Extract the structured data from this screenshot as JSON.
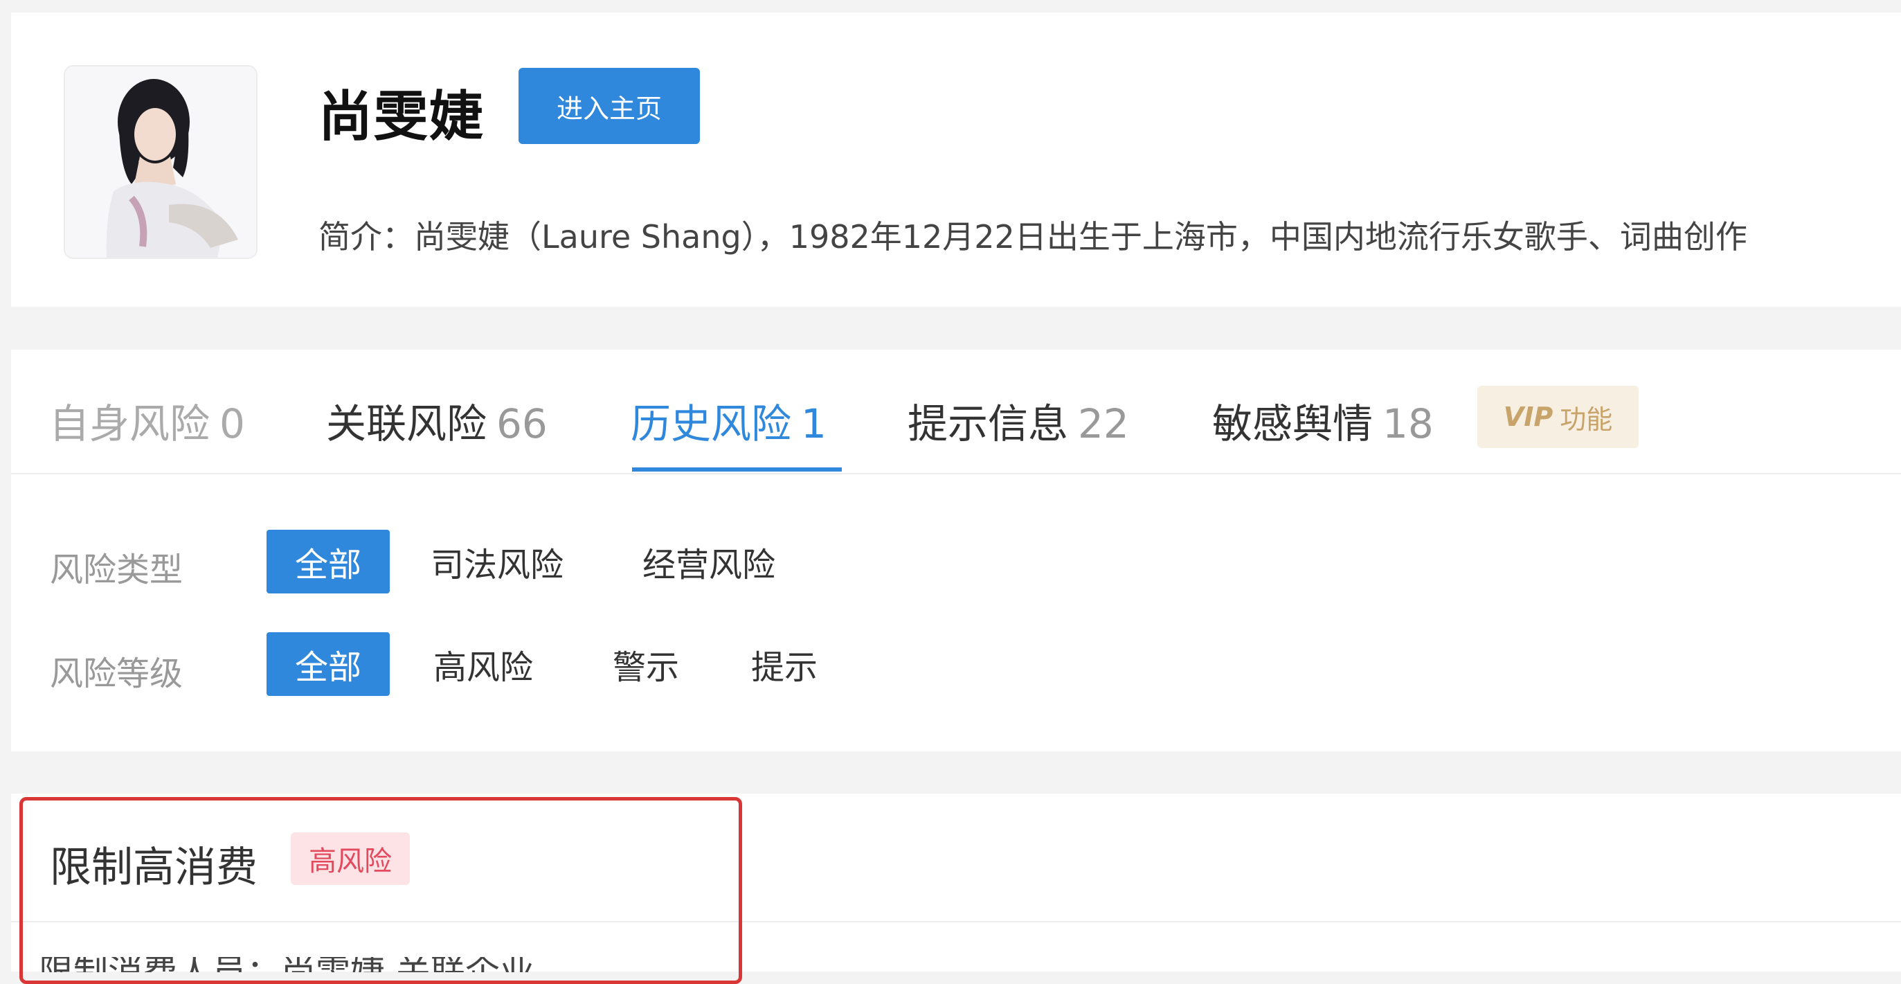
{
  "profile": {
    "name": "尚雯婕",
    "home_button": "进入主页",
    "intro": "简介：尚雯婕（Laure Shang），1982年12月22日出生于上海市，中国内地流行乐女歌手、词曲创作"
  },
  "tabs": [
    {
      "label": "自身风险",
      "count": "0",
      "state": "disabled"
    },
    {
      "label": "关联风险",
      "count": "66",
      "state": "normal"
    },
    {
      "label": "历史风险",
      "count": "1",
      "state": "active"
    },
    {
      "label": "提示信息",
      "count": "22",
      "state": "normal"
    },
    {
      "label": "敏感舆情",
      "count": "18",
      "state": "normal"
    }
  ],
  "vip": {
    "mark": "VIP",
    "text": "功能"
  },
  "filters": {
    "risk_type": {
      "label": "风险类型",
      "options": [
        "全部",
        "司法风险",
        "经营风险"
      ],
      "selected": "全部"
    },
    "risk_level": {
      "label": "风险等级",
      "options": [
        "全部",
        "高风险",
        "警示",
        "提示"
      ],
      "selected": "全部"
    }
  },
  "result": {
    "title": "限制高消费",
    "badge": "高风险",
    "peek": "限制消费人员：尚雯婕 关联企业"
  },
  "colors": {
    "primary": "#2f88db",
    "danger": "#d93636",
    "vip_gold": "#c8a36a"
  }
}
